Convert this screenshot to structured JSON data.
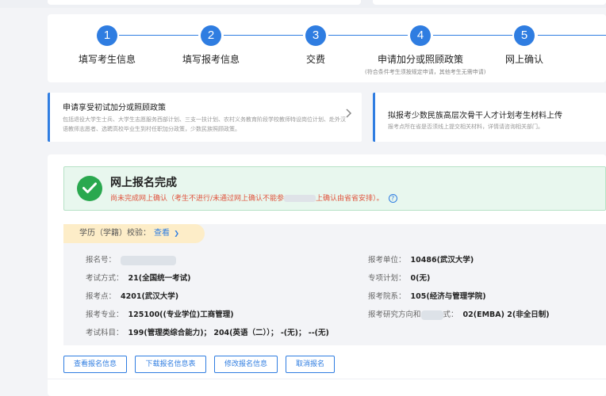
{
  "steps": [
    {
      "num": "1",
      "label": "填写考生信息",
      "sub": ""
    },
    {
      "num": "2",
      "label": "填写报考信息",
      "sub": ""
    },
    {
      "num": "3",
      "label": "交费",
      "sub": ""
    },
    {
      "num": "4",
      "label": "申请加分或照顾政策",
      "sub": "(符合条件考生须按规定申请，其他考生无需申请)"
    },
    {
      "num": "5",
      "label": "网上确认",
      "sub": ""
    }
  ],
  "info_cards": [
    {
      "title": "申请享受初试加分或照顾政策",
      "desc": "包括退役大学生士兵、大学生志愿服务西部计划、三支一扶计划、农村义务教育阶段学校教师特设岗位计划、赴外汉语教师志愿者、选聘高校毕业生到村任职加分政策，少数民族照顾政策。"
    },
    {
      "title": "拟报考少数民族高层次骨干人才计划考生材料上传",
      "desc": "报考点所在省是否须线上提交相关材料，详情请咨询相关部门。"
    }
  ],
  "success": {
    "title": "网上报名完成",
    "msg_a": "尚未完成网上确认（考生不进行/未通过网上确认不能参",
    "msg_b": "上确认由省省安排）。",
    "help": "?"
  },
  "detail": {
    "tag_label": "学历（学籍）校验：",
    "tag_link": "查看",
    "tag_chevron": "❯",
    "left": [
      {
        "label": "报名号：",
        "value": ""
      },
      {
        "label": "考试方式：",
        "value": "21(全国统一考试)"
      },
      {
        "label": "报考点：",
        "value": "4201(武汉大学)"
      },
      {
        "label": "报考专业：",
        "value": "125100((专业学位)工商管理)"
      },
      {
        "label": "考试科目：",
        "value": "199(管理类综合能力)； 204(英语（二））； -(无)； --(无)"
      }
    ],
    "right": [
      {
        "label": "报考单位：",
        "value": "10486(武汉大学)"
      },
      {
        "label": "专项计划：",
        "value": "0(无)"
      },
      {
        "label": "报考院系：",
        "value": "105(经济与管理学院)"
      },
      {
        "label_a": "报考研究方向和",
        "label_b": "式：",
        "value": "02(EMBA) 2(非全日制)"
      }
    ]
  },
  "buttons": [
    {
      "label": "查看报名信息"
    },
    {
      "label": "下载报名信息表"
    },
    {
      "label": "修改报名信息"
    },
    {
      "label": "取消报名"
    }
  ],
  "colors": {
    "accent": "#2f7de1",
    "success": "#2aa84f",
    "warning_text": "#e0533d",
    "tag_bg": "#fdedc8"
  },
  "icons": {
    "check": "check-circle-icon",
    "arrow": "chevron-right-icon",
    "help": "question-circle-icon"
  }
}
